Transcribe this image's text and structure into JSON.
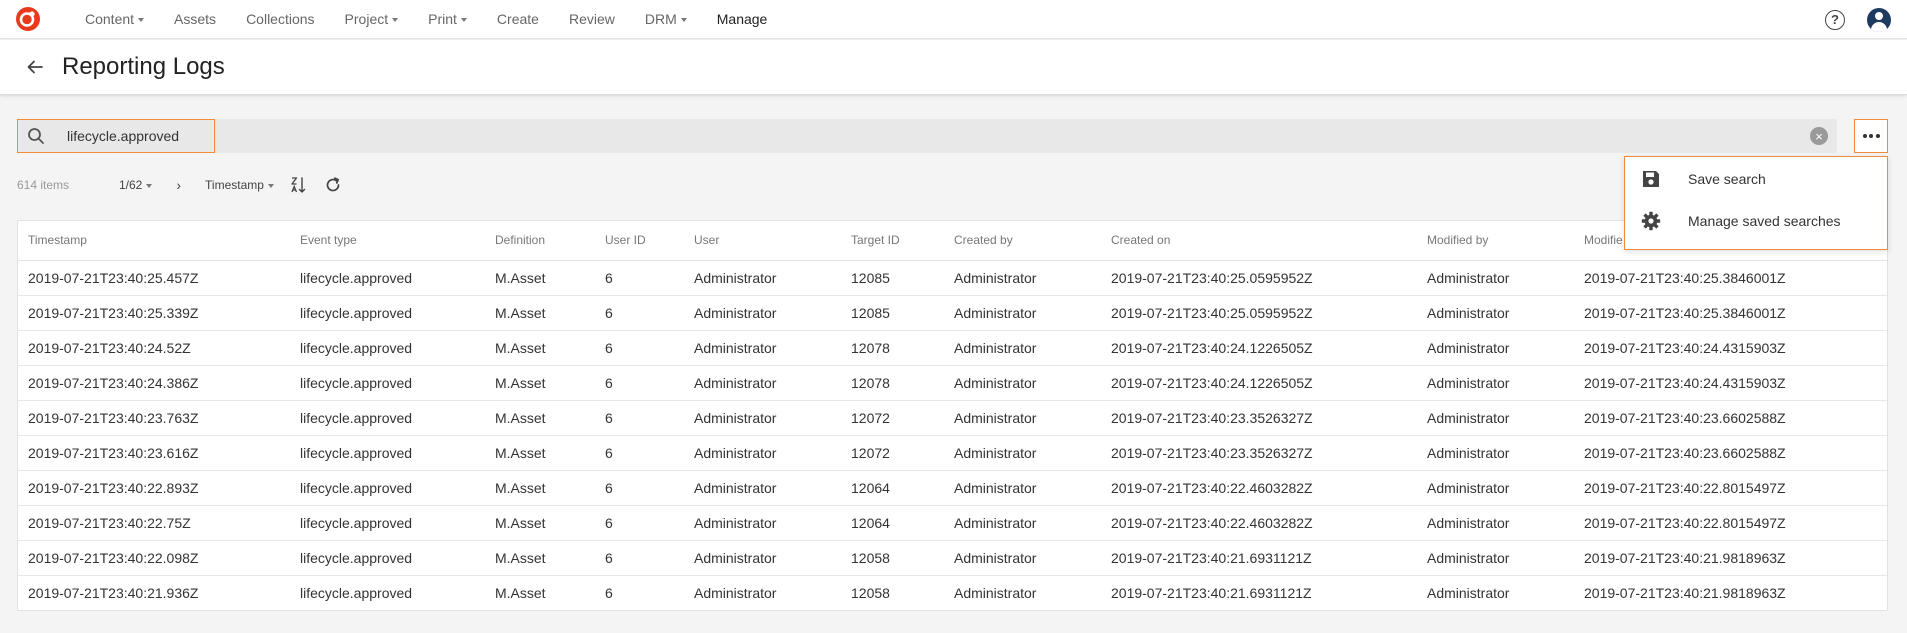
{
  "nav": {
    "items": [
      {
        "label": "Content",
        "dropdown": true
      },
      {
        "label": "Assets",
        "dropdown": false
      },
      {
        "label": "Collections",
        "dropdown": false
      },
      {
        "label": "Project",
        "dropdown": true
      },
      {
        "label": "Print",
        "dropdown": true
      },
      {
        "label": "Create",
        "dropdown": false
      },
      {
        "label": "Review",
        "dropdown": false
      },
      {
        "label": "DRM",
        "dropdown": true
      },
      {
        "label": "Manage",
        "dropdown": false,
        "active": true
      }
    ],
    "help_label": "?",
    "brand_color": "#e8391d"
  },
  "header": {
    "title": "Reporting Logs"
  },
  "search": {
    "value": "lifecycle.approved",
    "clear_label": "×"
  },
  "toolbar": {
    "item_count": "614 items",
    "page": "1/62",
    "next_label": "›",
    "sort_label": "Timestamp"
  },
  "menu": {
    "items": [
      {
        "label": "Save search",
        "icon": "save-icon"
      },
      {
        "label": "Manage saved searches",
        "icon": "gear-icon"
      }
    ]
  },
  "table": {
    "columns": [
      "Timestamp",
      "Event type",
      "Definition",
      "User ID",
      "User",
      "Target ID",
      "Created by",
      "Created on",
      "Modified by",
      "Modifie"
    ],
    "rows": [
      [
        "2019-07-21T23:40:25.457Z",
        "lifecycle.approved",
        "M.Asset",
        "6",
        "Administrator",
        "12085",
        "Administrator",
        "2019-07-21T23:40:25.0595952Z",
        "Administrator",
        "2019-07-21T23:40:25.3846001Z"
      ],
      [
        "2019-07-21T23:40:25.339Z",
        "lifecycle.approved",
        "M.Asset",
        "6",
        "Administrator",
        "12085",
        "Administrator",
        "2019-07-21T23:40:25.0595952Z",
        "Administrator",
        "2019-07-21T23:40:25.3846001Z"
      ],
      [
        "2019-07-21T23:40:24.52Z",
        "lifecycle.approved",
        "M.Asset",
        "6",
        "Administrator",
        "12078",
        "Administrator",
        "2019-07-21T23:40:24.1226505Z",
        "Administrator",
        "2019-07-21T23:40:24.4315903Z"
      ],
      [
        "2019-07-21T23:40:24.386Z",
        "lifecycle.approved",
        "M.Asset",
        "6",
        "Administrator",
        "12078",
        "Administrator",
        "2019-07-21T23:40:24.1226505Z",
        "Administrator",
        "2019-07-21T23:40:24.4315903Z"
      ],
      [
        "2019-07-21T23:40:23.763Z",
        "lifecycle.approved",
        "M.Asset",
        "6",
        "Administrator",
        "12072",
        "Administrator",
        "2019-07-21T23:40:23.3526327Z",
        "Administrator",
        "2019-07-21T23:40:23.6602588Z"
      ],
      [
        "2019-07-21T23:40:23.616Z",
        "lifecycle.approved",
        "M.Asset",
        "6",
        "Administrator",
        "12072",
        "Administrator",
        "2019-07-21T23:40:23.3526327Z",
        "Administrator",
        "2019-07-21T23:40:23.6602588Z"
      ],
      [
        "2019-07-21T23:40:22.893Z",
        "lifecycle.approved",
        "M.Asset",
        "6",
        "Administrator",
        "12064",
        "Administrator",
        "2019-07-21T23:40:22.4603282Z",
        "Administrator",
        "2019-07-21T23:40:22.8015497Z"
      ],
      [
        "2019-07-21T23:40:22.75Z",
        "lifecycle.approved",
        "M.Asset",
        "6",
        "Administrator",
        "12064",
        "Administrator",
        "2019-07-21T23:40:22.4603282Z",
        "Administrator",
        "2019-07-21T23:40:22.8015497Z"
      ],
      [
        "2019-07-21T23:40:22.098Z",
        "lifecycle.approved",
        "M.Asset",
        "6",
        "Administrator",
        "12058",
        "Administrator",
        "2019-07-21T23:40:21.6931121Z",
        "Administrator",
        "2019-07-21T23:40:21.9818963Z"
      ],
      [
        "2019-07-21T23:40:21.936Z",
        "lifecycle.approved",
        "M.Asset",
        "6",
        "Administrator",
        "12058",
        "Administrator",
        "2019-07-21T23:40:21.6931121Z",
        "Administrator",
        "2019-07-21T23:40:21.9818963Z"
      ]
    ]
  }
}
